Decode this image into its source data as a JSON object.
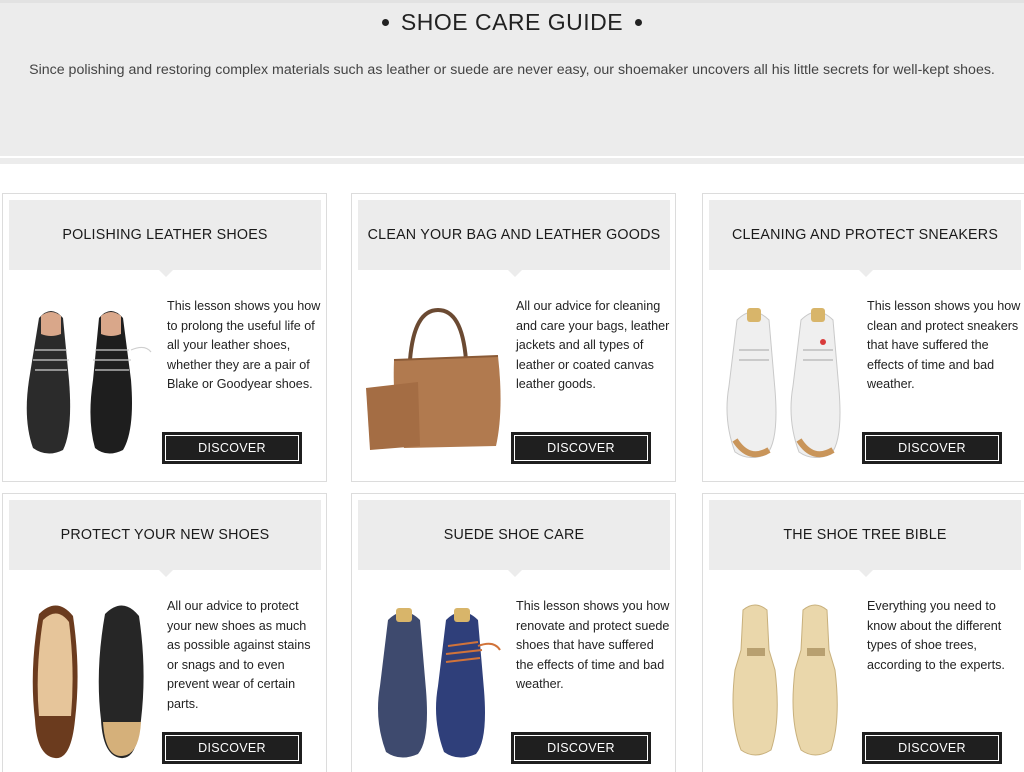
{
  "header": {
    "title": "SHOE CARE GUIDE",
    "subtitle": "Since polishing and restoring complex materials such as leather or suede are never easy, our shoemaker uncovers all his little secrets for well-kept shoes."
  },
  "cards": [
    {
      "title": "POLISHING LEATHER SHOES",
      "text": "This lesson shows you how to prolong the useful life of all your leather shoes, whether they are a pair of Blake or Goodyear shoes.",
      "button": "DISCOVER",
      "image": "black-leather-oxfords"
    },
    {
      "title": "CLEAN YOUR BAG AND LEATHER GOODS",
      "text": "All our advice for cleaning and care your bags, leather jackets and all types of leather or coated canvas leather goods.",
      "button": "DISCOVER",
      "image": "tan-leather-handbag"
    },
    {
      "title": "CLEANING AND PROTECT SNEAKERS",
      "text": "This lesson shows you how clean and protect sneakers that have suffered the effects of time and bad weather.",
      "button": "DISCOVER",
      "image": "white-sneakers"
    },
    {
      "title": "PROTECT YOUR NEW SHOES",
      "text": "All our advice to protect your new shoes as much as possible against stains or snags and to even prevent wear of certain parts.",
      "button": "DISCOVER",
      "image": "shoe-soles"
    },
    {
      "title": "SUEDE SHOE CARE",
      "text": "This lesson shows you how renovate and protect suede shoes that have suffered the effects of time and bad weather.",
      "button": "DISCOVER",
      "image": "blue-suede-shoes"
    },
    {
      "title": "THE SHOE TREE BIBLE",
      "text": "Everything you need to know about the different types of shoe trees, according to the experts.",
      "button": "DISCOVER",
      "image": "wooden-shoe-trees"
    }
  ]
}
